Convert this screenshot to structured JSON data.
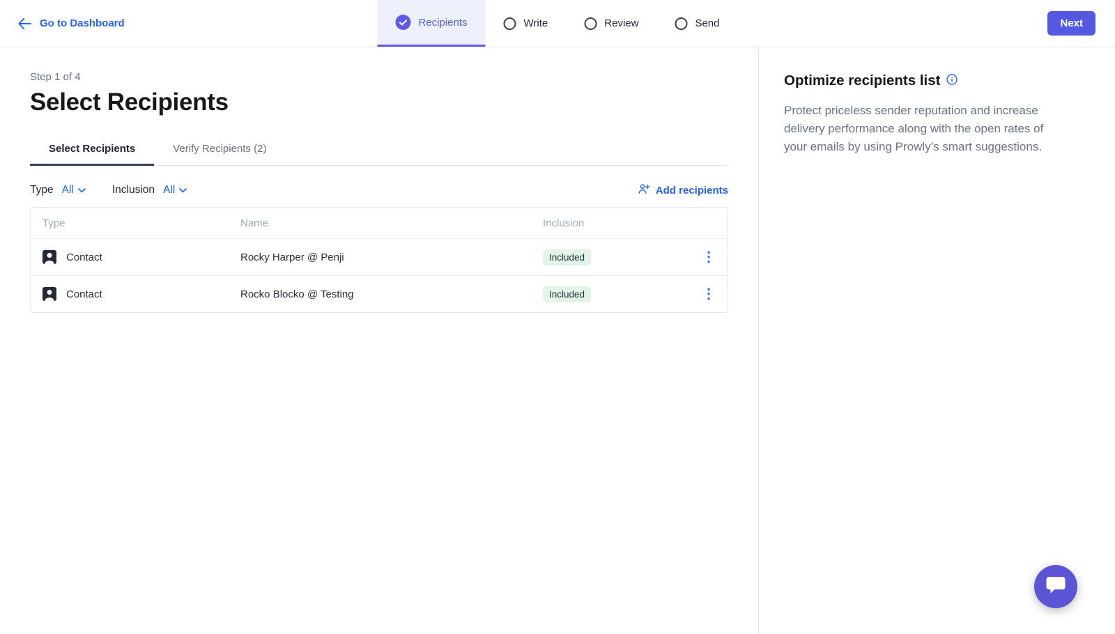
{
  "topbar": {
    "back_label": "Go to Dashboard",
    "steps": [
      {
        "label": "Recipients",
        "state": "active"
      },
      {
        "label": "Write",
        "state": "pending"
      },
      {
        "label": "Review",
        "state": "pending"
      },
      {
        "label": "Send",
        "state": "pending"
      }
    ],
    "next_label": "Next"
  },
  "main": {
    "step_indicator": "Step 1 of 4",
    "title": "Select Recipients",
    "tabs": [
      {
        "label": "Select Recipients",
        "active": true
      },
      {
        "label": "Verify Recipients (2)",
        "active": false
      }
    ],
    "filters": {
      "type_label": "Type",
      "type_value": "All",
      "inclusion_label": "Inclusion",
      "inclusion_value": "All",
      "add_recipients_label": "Add recipients"
    },
    "table": {
      "headers": [
        "Type",
        "Name",
        "Inclusion"
      ],
      "rows": [
        {
          "type": "Contact",
          "name": "Rocky Harper @ Penji",
          "inclusion": "Included"
        },
        {
          "type": "Contact",
          "name": "Rocko Blocko @ Testing",
          "inclusion": "Included"
        }
      ]
    }
  },
  "sidebar": {
    "title": "Optimize recipients list",
    "description": "Protect priceless sender reputation and increase delivery performance along with the open rates of your emails by using Prowly’s smart suggestions."
  },
  "colors": {
    "accent_purple": "#5e5ce6",
    "link_blue": "#2563eb",
    "badge_bg": "#e1f4e6",
    "tab_underline": "#3a4154"
  }
}
